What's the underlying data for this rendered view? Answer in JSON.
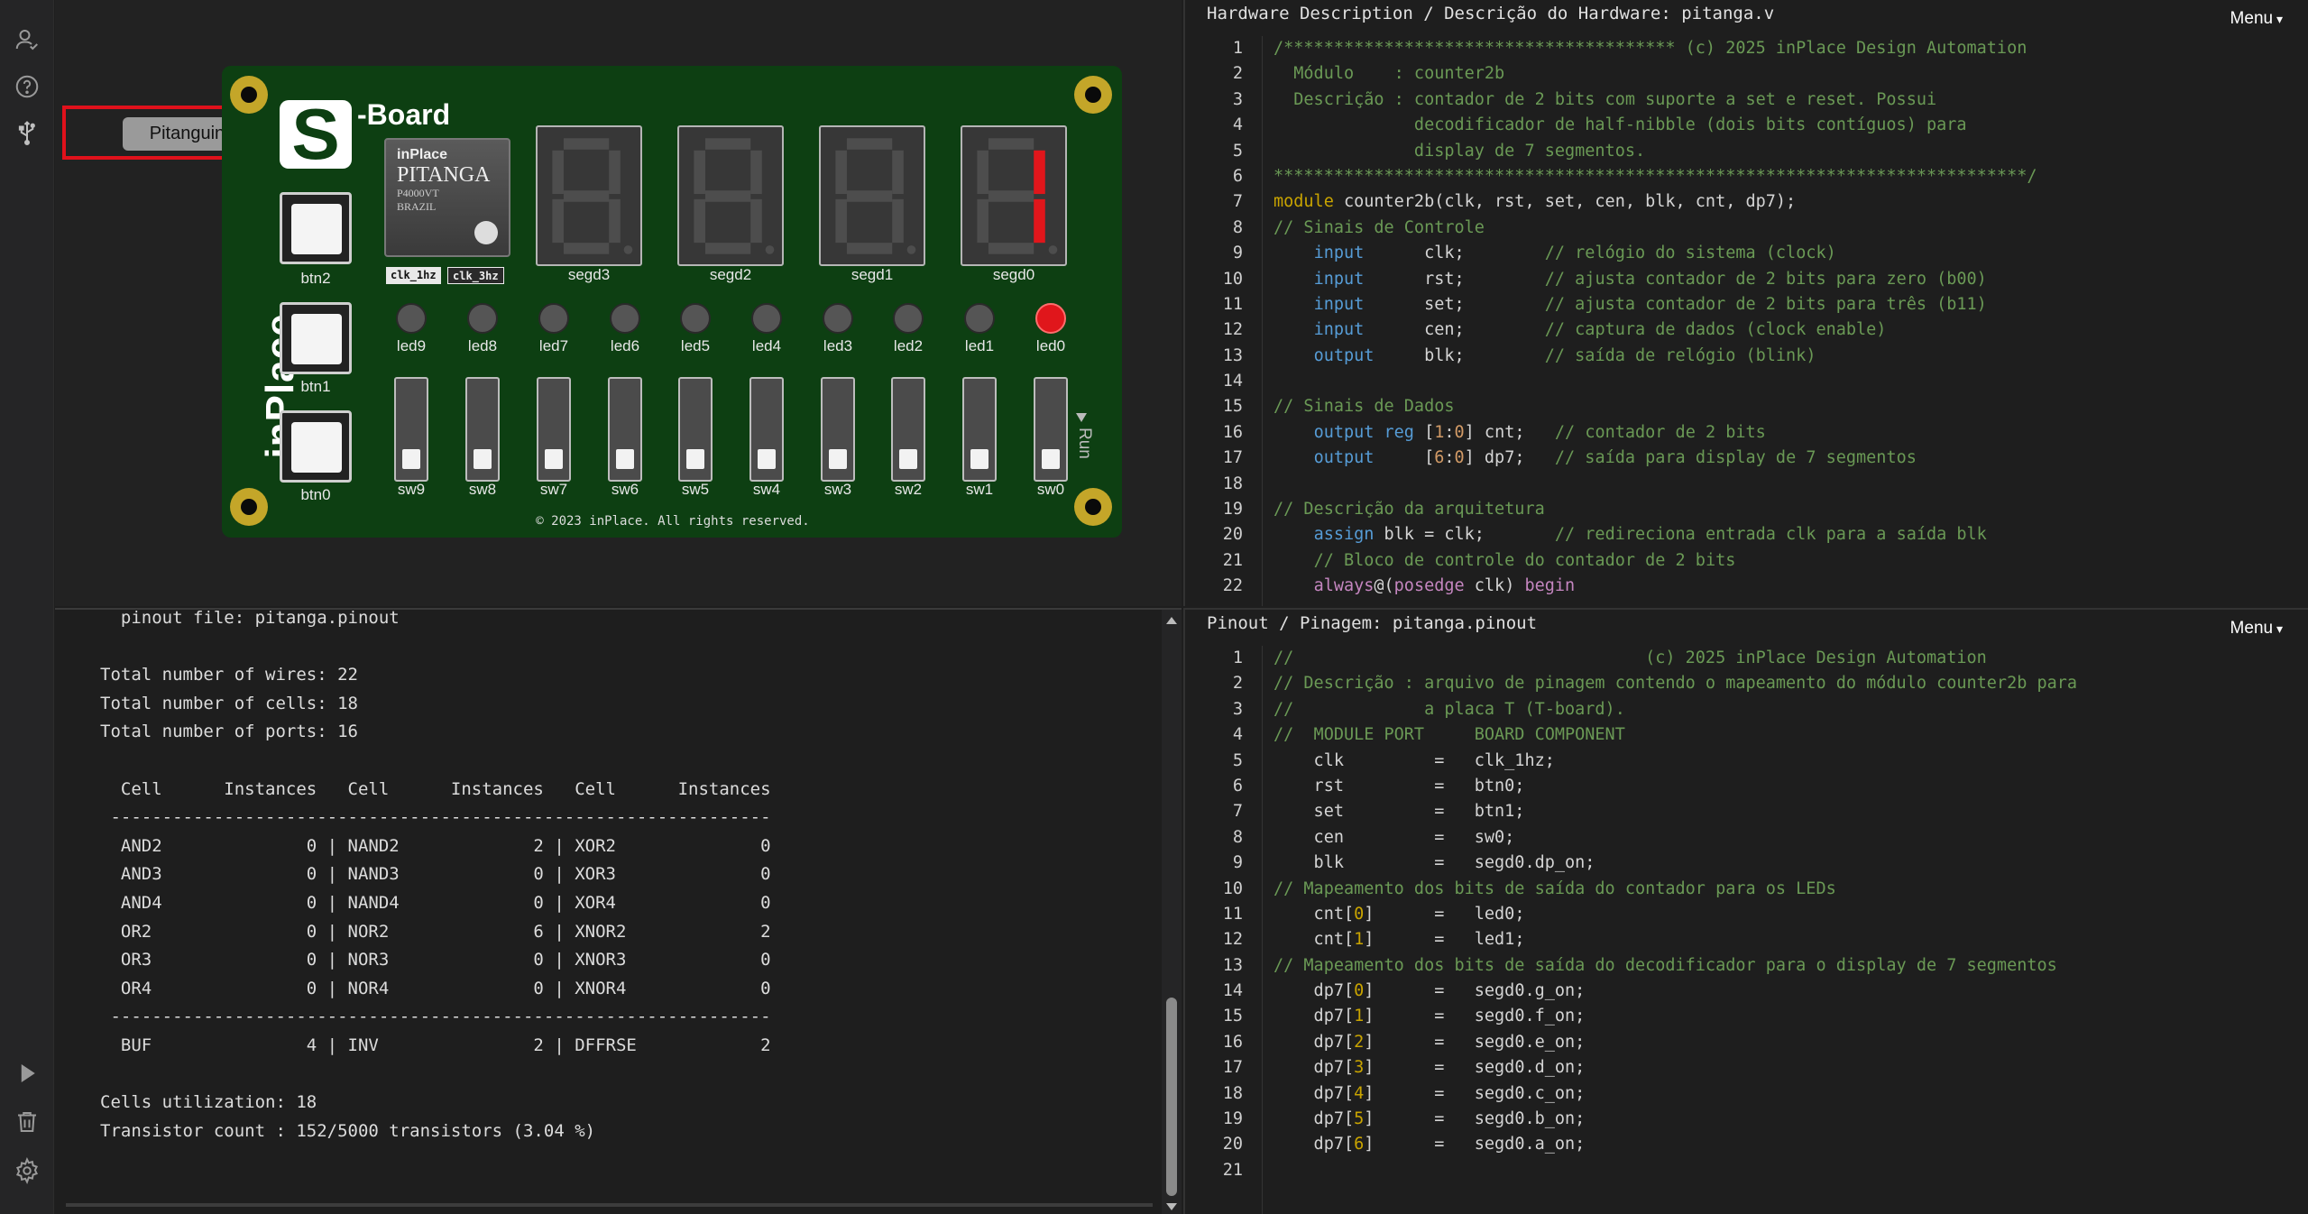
{
  "sidebar": {
    "icons": [
      "user-check-icon",
      "help-icon",
      "usb-icon",
      "run-icon",
      "trash-icon",
      "settings-icon"
    ]
  },
  "board": {
    "popup_label": "Pitanguino",
    "logo_letter": "S",
    "logo_text": "-Board",
    "brand_vertical": "inPlace",
    "chip": {
      "brand": "inPlace",
      "name": "PITANGA",
      "part": "P4000VT",
      "origin": "BRAZIL"
    },
    "clock_labels": [
      "clk_1hz",
      "clk_3hz"
    ],
    "displays": [
      "segd3",
      "segd2",
      "segd1",
      "segd0"
    ],
    "buttons": [
      "btn2",
      "btn1",
      "btn0"
    ],
    "leds": [
      "led9",
      "led8",
      "led7",
      "led6",
      "led5",
      "led4",
      "led3",
      "led2",
      "led1",
      "led0"
    ],
    "led_on": "led0",
    "switches": [
      "sw9",
      "sw8",
      "sw7",
      "sw6",
      "sw5",
      "sw4",
      "sw3",
      "sw2",
      "sw1",
      "sw0"
    ],
    "copyright": "© 2023 inPlace. All rights reserved.",
    "run_label": "Run"
  },
  "console": {
    "lines": [
      "  pinout file: pitanga.pinout",
      "",
      "Total number of wires: 22",
      "Total number of cells: 18",
      "Total number of ports: 16",
      "",
      "  Cell      Instances   Cell      Instances   Cell      Instances",
      " ----------------------------------------------------------------",
      "  AND2              0 | NAND2             2 | XOR2              0",
      "  AND3              0 | NAND3             0 | XOR3              0",
      "  AND4              0 | NAND4             0 | XOR4              0",
      "  OR2               0 | NOR2              6 | XNOR2             2",
      "  OR3               0 | NOR3              0 | XNOR3             0",
      "  OR4               0 | NOR4              0 | XNOR4             0",
      " ----------------------------------------------------------------",
      "  BUF               4 | INV               2 | DFFRSE            2",
      "",
      "Cells utilization: 18",
      "Transistor count : 152/5000 transistors (3.04 %)"
    ]
  },
  "hw_panel": {
    "title": "Hardware Description / Descrição do Hardware: pitanga.v",
    "menu": "Menu",
    "lines": [
      [
        [
          "c",
          "/*************************************** (c) 2025 inPlace Design Automation"
        ]
      ],
      [
        [
          "c",
          "  Módulo    : counter2b"
        ]
      ],
      [
        [
          "c",
          "  Descrição : contador de 2 bits com suporte a set e reset. Possui"
        ]
      ],
      [
        [
          "c",
          "              decodificador de half-nibble (dois bits contíguos) para"
        ]
      ],
      [
        [
          "c",
          "              display de 7 segmentos."
        ]
      ],
      [
        [
          "c",
          "***************************************************************************/"
        ]
      ],
      [
        [
          "k",
          "module"
        ],
        [
          "v",
          " counter2b(clk, rst, set, cen, blk, cnt, dp7);"
        ]
      ],
      [
        [
          "c",
          "// Sinais de Controle"
        ]
      ],
      [
        [
          "v",
          "    "
        ],
        [
          "t",
          "input"
        ],
        [
          "v",
          "      clk;        "
        ],
        [
          "c",
          "// relógio do sistema (clock)"
        ]
      ],
      [
        [
          "v",
          "    "
        ],
        [
          "t",
          "input"
        ],
        [
          "v",
          "      rst;        "
        ],
        [
          "c",
          "// ajusta contador de 2 bits para zero (b00)"
        ]
      ],
      [
        [
          "v",
          "    "
        ],
        [
          "t",
          "input"
        ],
        [
          "v",
          "      set;        "
        ],
        [
          "c",
          "// ajusta contador de 2 bits para três (b11)"
        ]
      ],
      [
        [
          "v",
          "    "
        ],
        [
          "t",
          "input"
        ],
        [
          "v",
          "      cen;        "
        ],
        [
          "c",
          "// captura de dados (clock enable)"
        ]
      ],
      [
        [
          "v",
          "    "
        ],
        [
          "t",
          "output"
        ],
        [
          "v",
          "     blk;        "
        ],
        [
          "c",
          "// saída de relógio (blink)"
        ]
      ],
      [],
      [
        [
          "c",
          "// Sinais de Dados"
        ]
      ],
      [
        [
          "v",
          "    "
        ],
        [
          "t",
          "output"
        ],
        [
          "v",
          " "
        ],
        [
          "t",
          "reg"
        ],
        [
          "v",
          " ["
        ],
        [
          "n",
          "1"
        ],
        [
          "v",
          ":"
        ],
        [
          "n",
          "0"
        ],
        [
          "v",
          "] cnt;   "
        ],
        [
          "c",
          "// contador de 2 bits"
        ]
      ],
      [
        [
          "v",
          "    "
        ],
        [
          "t",
          "output"
        ],
        [
          "v",
          "     ["
        ],
        [
          "n",
          "6"
        ],
        [
          "v",
          ":"
        ],
        [
          "n",
          "0"
        ],
        [
          "v",
          "] dp7;   "
        ],
        [
          "c",
          "// saída para display de 7 segmentos"
        ]
      ],
      [],
      [
        [
          "c",
          "// Descrição da arquitetura"
        ]
      ],
      [
        [
          "v",
          "    "
        ],
        [
          "t",
          "assign"
        ],
        [
          "v",
          " blk = clk;       "
        ],
        [
          "c",
          "// redireciona entrada clk para a saída blk"
        ]
      ],
      [
        [
          "v",
          "    "
        ],
        [
          "c",
          "// Bloco de controle do contador de 2 bits"
        ]
      ],
      [
        [
          "v",
          "    "
        ],
        [
          "p",
          "always"
        ],
        [
          "v",
          "@("
        ],
        [
          "p",
          "posedge"
        ],
        [
          "v",
          " clk) "
        ],
        [
          "p",
          "begin"
        ]
      ]
    ]
  },
  "pin_panel": {
    "title": "Pinout / Pinagem: pitanga.pinout",
    "menu": "Menu",
    "lines": [
      [
        [
          "c",
          "//                                   (c) 2025 inPlace Design Automation"
        ]
      ],
      [
        [
          "c",
          "// Descrição : arquivo de pinagem contendo o mapeamento do módulo counter2b para"
        ]
      ],
      [
        [
          "c",
          "//             a placa T (T-board)."
        ]
      ],
      [
        [
          "c",
          "//  MODULE PORT     BOARD COMPONENT"
        ]
      ],
      [
        [
          "v",
          "    clk         =   clk_1hz;"
        ]
      ],
      [
        [
          "v",
          "    rst         =   btn0;"
        ]
      ],
      [
        [
          "v",
          "    set         =   btn1;"
        ]
      ],
      [
        [
          "v",
          "    cen         =   sw0;"
        ]
      ],
      [
        [
          "v",
          "    blk         =   segd0.dp_on;"
        ]
      ],
      [
        [
          "c",
          "// Mapeamento dos bits de saída do contador para os LEDs"
        ]
      ],
      [
        [
          "v",
          "    cnt["
        ],
        [
          "k",
          "0"
        ],
        [
          "v",
          "]      =   led0;"
        ]
      ],
      [
        [
          "v",
          "    cnt["
        ],
        [
          "k",
          "1"
        ],
        [
          "v",
          "]      =   led1;"
        ]
      ],
      [
        [
          "c",
          "// Mapeamento dos bits de saída do decodificador para o display de 7 segmentos"
        ]
      ],
      [
        [
          "v",
          "    dp7["
        ],
        [
          "k",
          "0"
        ],
        [
          "v",
          "]      =   segd0.g_on;"
        ]
      ],
      [
        [
          "v",
          "    dp7["
        ],
        [
          "k",
          "1"
        ],
        [
          "v",
          "]      =   segd0.f_on;"
        ]
      ],
      [
        [
          "v",
          "    dp7["
        ],
        [
          "k",
          "2"
        ],
        [
          "v",
          "]      =   segd0.e_on;"
        ]
      ],
      [
        [
          "v",
          "    dp7["
        ],
        [
          "k",
          "3"
        ],
        [
          "v",
          "]      =   segd0.d_on;"
        ]
      ],
      [
        [
          "v",
          "    dp7["
        ],
        [
          "k",
          "4"
        ],
        [
          "v",
          "]      =   segd0.c_on;"
        ]
      ],
      [
        [
          "v",
          "    dp7["
        ],
        [
          "k",
          "5"
        ],
        [
          "v",
          "]      =   segd0.b_on;"
        ]
      ],
      [
        [
          "v",
          "    dp7["
        ],
        [
          "k",
          "6"
        ],
        [
          "v",
          "]      =   segd0.a_on;"
        ]
      ],
      []
    ]
  },
  "colors": {
    "pcb": "#0d3f12",
    "highlight": "#e0111b",
    "led_on": "#e0161b",
    "segment_on": "#e0161b",
    "keyword": "#c9a400",
    "type": "#569cd6",
    "comment": "#6a9955"
  }
}
